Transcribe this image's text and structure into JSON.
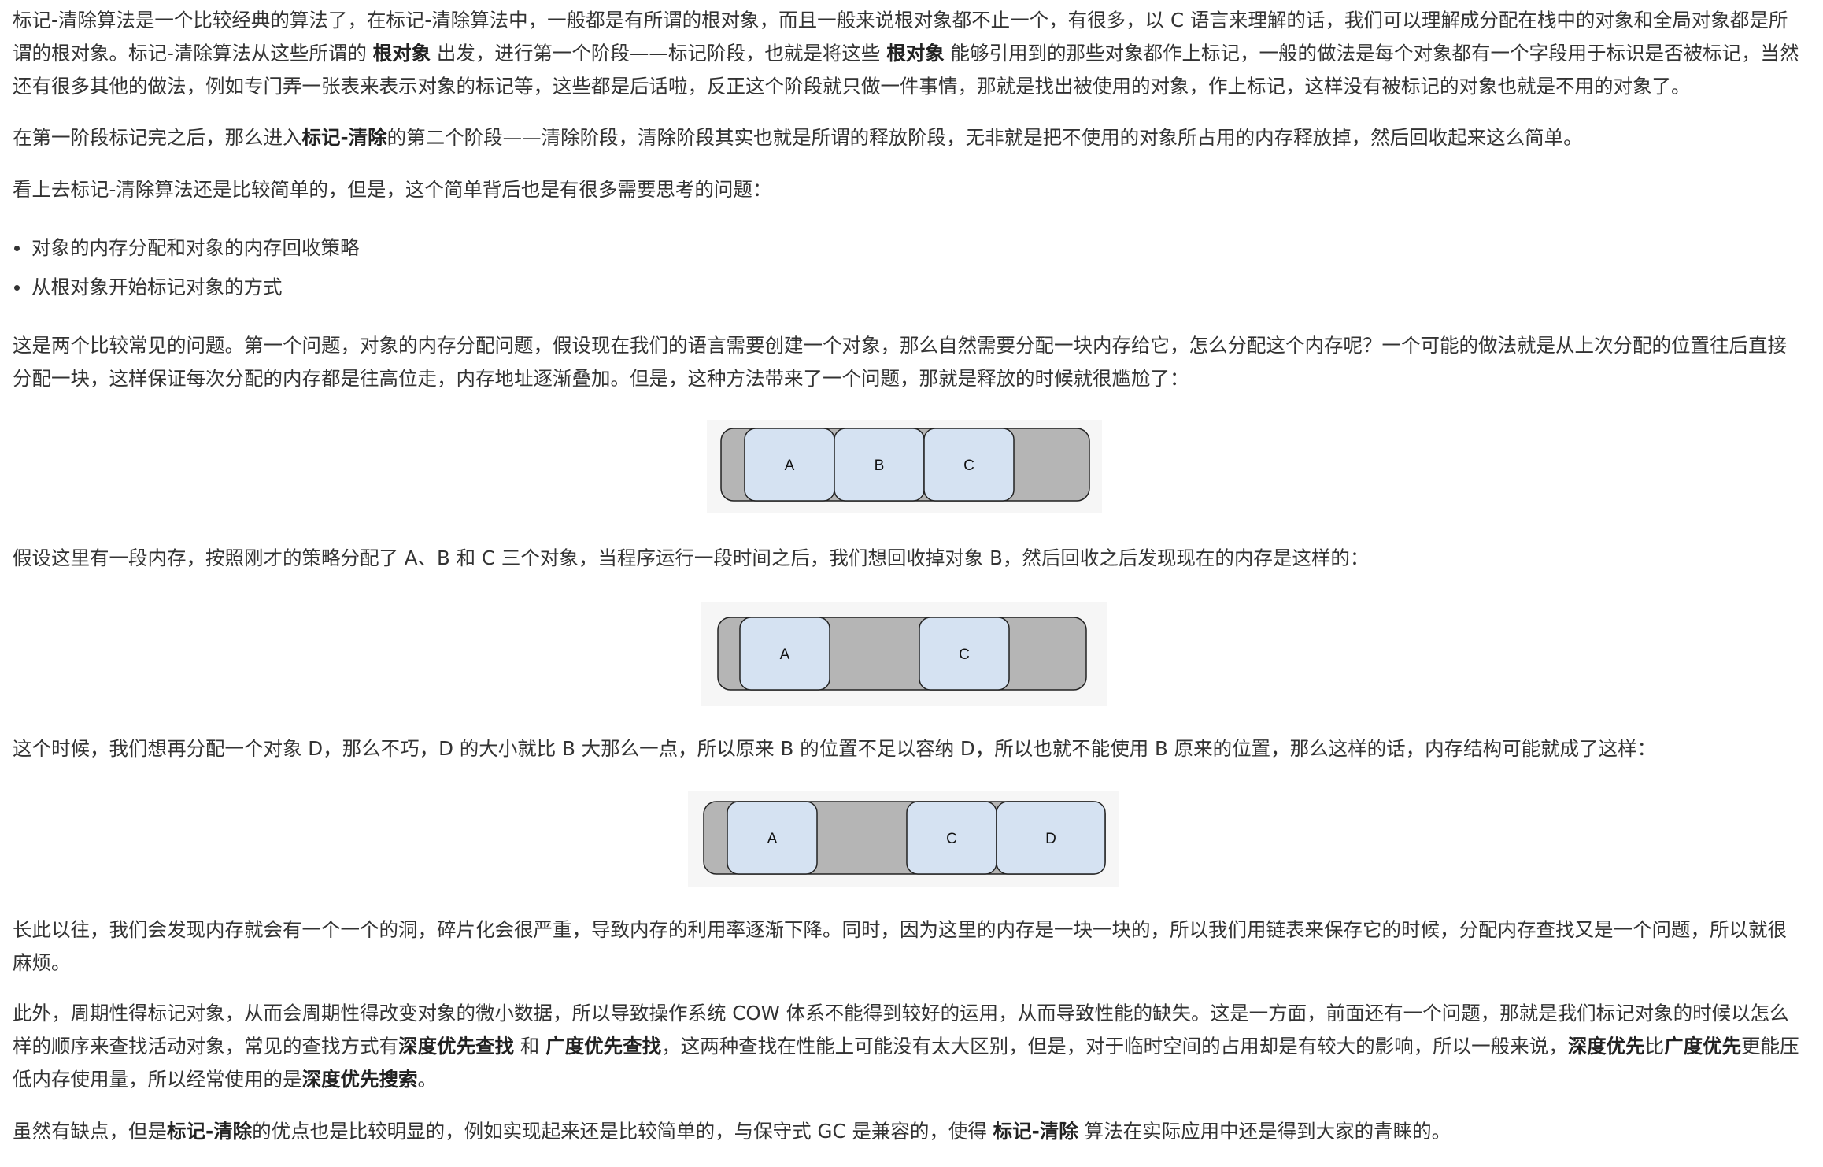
{
  "p1": [
    {
      "t": "标记-清除算法是一个比较经典的算法了，在标记-清除算法中，一般都是有所谓的根对象，而且一般来说根对象都不止一个，有很多，以 C 语言来理解的话，我们可以理解成分配在栈中的对象和全局对象都是所谓的根对象。标记-清除算法从这些所谓的 ",
      "b": false
    },
    {
      "t": "根对象",
      "b": true
    },
    {
      "t": " 出发，进行第一个阶段——标记阶段，也就是将这些 ",
      "b": false
    },
    {
      "t": "根对象",
      "b": true
    },
    {
      "t": " 能够引用到的那些对象都作上标记，一般的做法是每个对象都有一个字段用于标识是否被标记，当然还有很多其他的做法，例如专门弄一张表来表示对象的标记等，这些都是后话啦，反正这个阶段就只做一件事情，那就是找出被使用的对象，作上标记，这样没有被标记的对象也就是不用的对象了。",
      "b": false
    }
  ],
  "p2": [
    {
      "t": "在第一阶段标记完之后，那么进入",
      "b": false
    },
    {
      "t": "标记-清除",
      "b": true
    },
    {
      "t": "的第二个阶段——清除阶段，清除阶段其实也就是所谓的释放阶段，无非就是把不使用的对象所占用的内存释放掉，然后回收起来这么简单。",
      "b": false
    }
  ],
  "p3": "看上去标记-清除算法还是比较简单的，但是，这个简单背后也是有很多需要思考的问题：",
  "list": [
    "对象的内存分配和对象的内存回收策略",
    "从根对象开始标记对象的方式"
  ],
  "p4": "这是两个比较常见的问题。第一个问题，对象的内存分配问题，假设现在我们的语言需要创建一个对象，那么自然需要分配一块内存给它，怎么分配这个内存呢？一个可能的做法就是从上次分配的位置往后直接分配一块，这样保证每次分配的内存都是往高位走，内存地址逐渐叠加。但是，这种方法带来了一个问题，那就是释放的时候就很尴尬了：",
  "fig1": {
    "blocks": [
      "A",
      "B",
      "C"
    ]
  },
  "p5": "假设这里有一段内存，按照刚才的策略分配了 A、B 和 C 三个对象，当程序运行一段时间之后，我们想回收掉对象 B，然后回收之后发现现在的内存是这样的：",
  "fig2": {
    "blocks": [
      "A",
      "C"
    ]
  },
  "p6": "这个时候，我们想再分配一个对象 D，那么不巧，D 的大小就比 B 大那么一点，所以原来 B 的位置不足以容纳 D，所以也就不能使用 B 原来的位置，那么这样的话，内存结构可能就成了这样：",
  "fig3": {
    "blocks": [
      "A",
      "C",
      "D"
    ]
  },
  "p7": "长此以往，我们会发现内存就会有一个一个的洞，碎片化会很严重，导致内存的利用率逐渐下降。同时，因为这里的内存是一块一块的，所以我们用链表来保存它的时候，分配内存查找又是一个问题，所以就很麻烦。",
  "p8": [
    {
      "t": "此外，周期性得标记对象，从而会周期性得改变对象的微小数据，所以导致操作系统 COW 体系不能得到较好的运用，从而导致性能的缺失。这是一方面，前面还有一个问题，那就是我们标记对象的时候以怎么样的顺序来查找活动对象，常见的查找方式有",
      "b": false
    },
    {
      "t": "深度优先查找",
      "b": true
    },
    {
      "t": " 和 ",
      "b": false
    },
    {
      "t": "广度优先查找",
      "b": true
    },
    {
      "t": "，这两种查找在性能上可能没有太大区别，但是，对于临时空间的占用却是有较大的影响，所以一般来说，",
      "b": false
    },
    {
      "t": "深度优先",
      "b": true
    },
    {
      "t": "比",
      "b": false
    },
    {
      "t": "广度优先",
      "b": true
    },
    {
      "t": "更能压低内存使用量，所以经常使用的是",
      "b": false
    },
    {
      "t": "深度优先搜索",
      "b": true
    },
    {
      "t": "。",
      "b": false
    }
  ],
  "p9": [
    {
      "t": "虽然有缺点，但是",
      "b": false
    },
    {
      "t": "标记-清除",
      "b": true
    },
    {
      "t": "的优点也是比较明显的，例如实现起来还是比较简单的，与保守式 GC 是兼容的，使得 ",
      "b": false
    },
    {
      "t": "标记-清除",
      "b": true
    },
    {
      "t": " 算法在实际应用中还是得到大家的青睐的。",
      "b": false
    }
  ],
  "colors": {
    "memory_bar": "#b5b5b5",
    "block_fill": "#d5e2f2",
    "block_border": "#222222",
    "text": "#333333"
  }
}
